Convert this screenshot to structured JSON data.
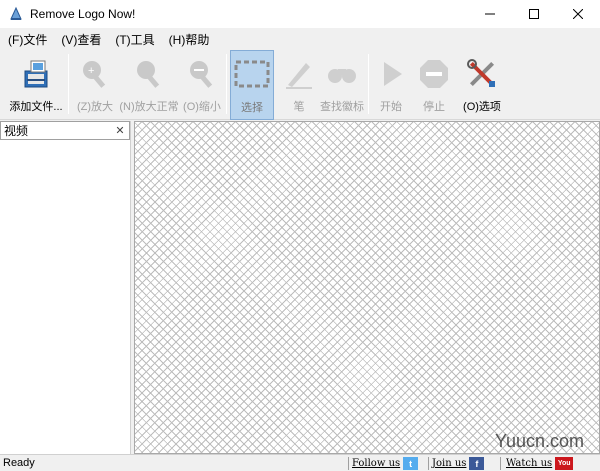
{
  "window": {
    "title": "Remove Logo Now!",
    "controls": {
      "minimize": "—",
      "maximize": "☐",
      "close": "✕"
    }
  },
  "menu": [
    {
      "label": "(F)文件"
    },
    {
      "label": "(V)查看"
    },
    {
      "label": "(T)工具"
    },
    {
      "label": "(H)帮助"
    }
  ],
  "toolbar": {
    "add_file": "添加文件...",
    "zoom_in": "(Z)放大",
    "zoom_normal": "(N)放大正常",
    "zoom_out": "(O)缩小",
    "select": "选择",
    "pen": "笔",
    "find_logo": "查找徽标",
    "start": "开始",
    "stop": "停止",
    "options": "(O)选项"
  },
  "panel": {
    "title": "视频",
    "close": "✕"
  },
  "status": {
    "text": "Ready",
    "follow": "Follow us",
    "join": "Join us",
    "watch": "Watch us",
    "twitter_glyph": "t",
    "facebook_glyph": "f",
    "youtube_glyph": "You"
  },
  "watermark": "Yuucn.com",
  "colors": {
    "selected_bg": "#b8d4ee",
    "twitter": "#55acee",
    "facebook": "#3b5998",
    "youtube": "#cc181e"
  }
}
